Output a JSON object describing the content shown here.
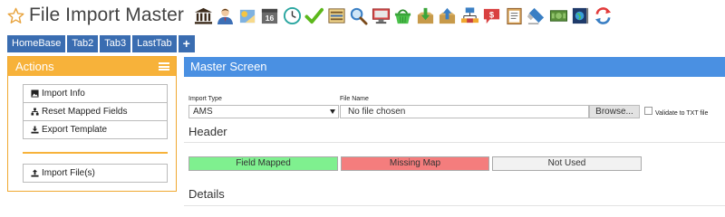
{
  "app": {
    "title": "File Import Master"
  },
  "toolbar": {
    "icons": [
      "bank-icon",
      "user-icon",
      "note-icon",
      "calendar-icon",
      "clock-icon",
      "checkmark-icon",
      "register-icon",
      "magnifier-icon",
      "monitor-icon",
      "basket-icon",
      "download-box-icon",
      "upload-box-icon",
      "network-icon",
      "dollar-chat-icon",
      "clipboard-icon",
      "eraser-icon",
      "cash-icon",
      "globe-book-icon",
      "refresh-icon"
    ],
    "calendar_day": "16"
  },
  "tabs": [
    "HomeBase",
    "Tab2",
    "Tab3",
    "LastTab",
    "+"
  ],
  "actions": {
    "title": "Actions",
    "buttons": [
      "Import Info",
      "Reset Mapped Fields",
      "Export Template"
    ],
    "import_button": "Import File(s)"
  },
  "master": {
    "title": "Master Screen",
    "import_type_label": "Import Type",
    "import_type_value": "AMS",
    "file_name_label": "File Name",
    "file_placeholder": "No file chosen",
    "browse_label": "Browse...",
    "validate_label": "Validate to TXT file",
    "header_section": "Header",
    "details_section": "Details",
    "legend": [
      {
        "label": "Field Mapped",
        "color": "#7ff08f"
      },
      {
        "label": "Missing Map",
        "color": "#f47d7d"
      },
      {
        "label": "Not Used",
        "color": "#f2f2f2"
      }
    ]
  },
  "colors": {
    "tab_blue": "#3a6db1",
    "actions_orange": "#f7b23a",
    "master_blue": "#4a90e2"
  }
}
